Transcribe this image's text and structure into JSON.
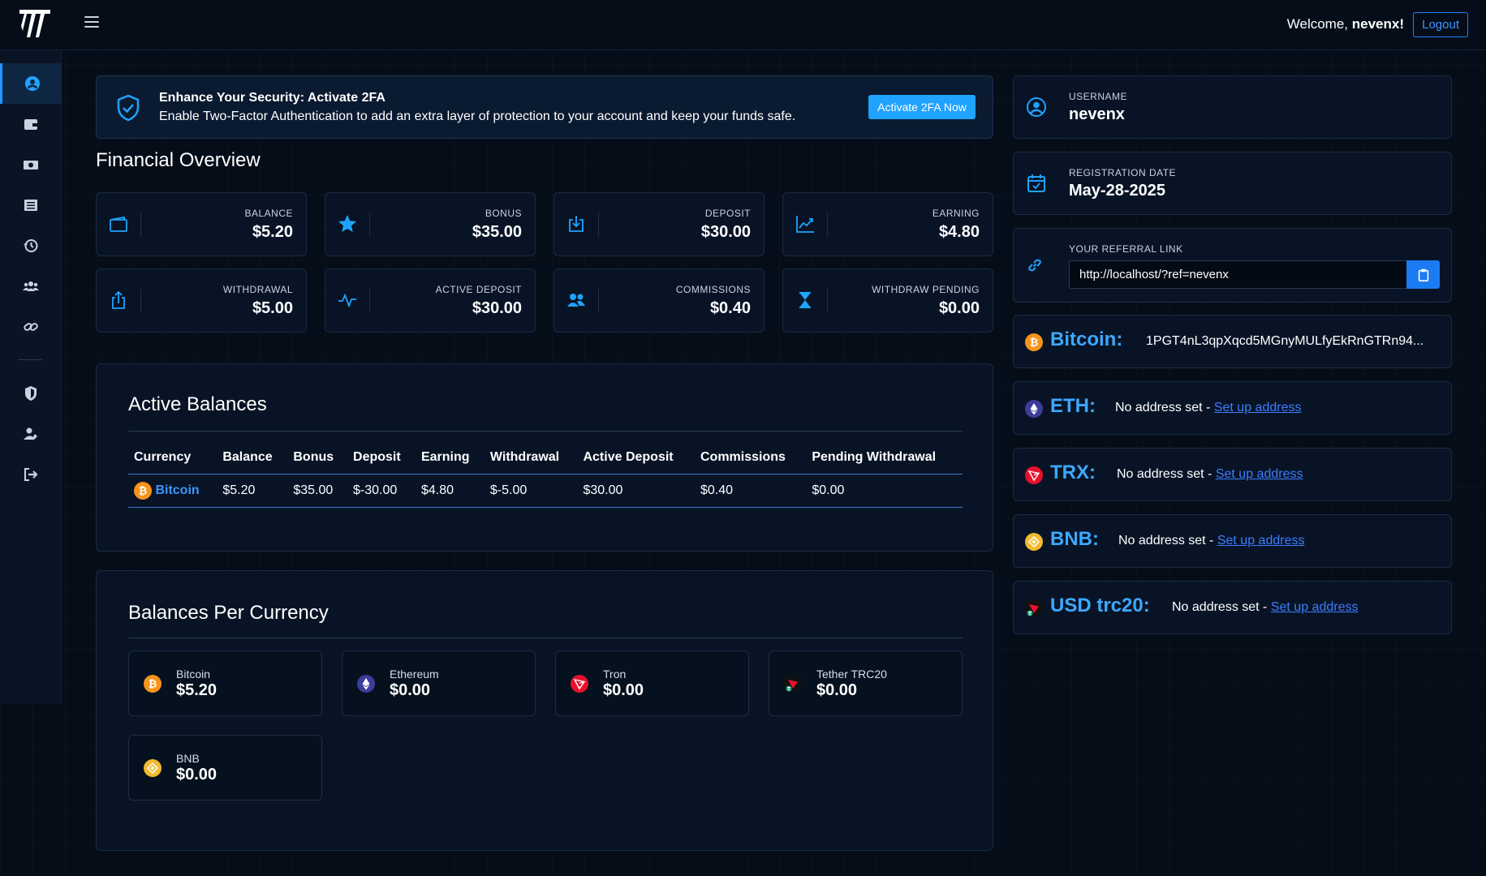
{
  "header": {
    "welcome_prefix": "Welcome,",
    "username": "nevenx!",
    "logout_label": "Logout"
  },
  "sidebar": {
    "items": [
      {
        "icon": "user-circle-icon",
        "active": true
      },
      {
        "icon": "wallet-icon"
      },
      {
        "icon": "money-icon"
      },
      {
        "icon": "list-icon"
      },
      {
        "icon": "history-icon"
      },
      {
        "icon": "users-icon"
      },
      {
        "icon": "link-icon"
      },
      {
        "icon": "shield-icon"
      },
      {
        "icon": "user-edit-icon"
      },
      {
        "icon": "sign-out-icon"
      }
    ]
  },
  "banner": {
    "title": "Enhance Your Security: Activate 2FA",
    "text": "Enable Two-Factor Authentication to add an extra layer of protection to your account and keep your funds safe.",
    "button": "Activate 2FA Now"
  },
  "overview": {
    "title": "Financial Overview",
    "stats": [
      {
        "label": "BALANCE",
        "value": "$5.20",
        "icon": "wallet-icon"
      },
      {
        "label": "BONUS",
        "value": "$35.00",
        "icon": "star-icon"
      },
      {
        "label": "DEPOSIT",
        "value": "$30.00",
        "icon": "download-icon"
      },
      {
        "label": "EARNING",
        "value": "$4.80",
        "icon": "chart-line-icon"
      },
      {
        "label": "WITHDRAWAL",
        "value": "$5.00",
        "icon": "upload-icon"
      },
      {
        "label": "ACTIVE DEPOSIT",
        "value": "$30.00",
        "icon": "pulse-icon"
      },
      {
        "label": "COMMISSIONS",
        "value": "$0.40",
        "icon": "users-icon"
      },
      {
        "label": "WITHDRAW PENDING",
        "value": "$0.00",
        "icon": "hourglass-icon"
      }
    ]
  },
  "active_balances": {
    "title": "Active Balances",
    "headers": [
      "Currency",
      "Balance",
      "Bonus",
      "Deposit",
      "Earning",
      "Withdrawal",
      "Active Deposit",
      "Commissions",
      "Pending Withdrawal"
    ],
    "rows": [
      {
        "currency": "Bitcoin",
        "balance": "$5.20",
        "bonus": "$35.00",
        "deposit": "$-30.00",
        "earning": "$4.80",
        "withdrawal": "$-5.00",
        "active_deposit": "$30.00",
        "commissions": "$0.40",
        "pending": "$0.00"
      }
    ]
  },
  "per_currency": {
    "title": "Balances Per Currency",
    "items": [
      {
        "name": "Bitcoin",
        "value": "$5.20",
        "icon": "bitcoin-icon",
        "color": "#f7931a"
      },
      {
        "name": "Ethereum",
        "value": "$0.00",
        "icon": "ethereum-icon",
        "color": "#3c3c9c"
      },
      {
        "name": "Tron",
        "value": "$0.00",
        "icon": "tron-icon",
        "color": "#e8112d"
      },
      {
        "name": "Tether TRC20",
        "value": "$0.00",
        "icon": "tether-trc20-icon",
        "color": "#111111"
      },
      {
        "name": "BNB",
        "value": "$0.00",
        "icon": "bnb-icon",
        "color": "#f3ba2f"
      }
    ]
  },
  "profile": {
    "username_label": "USERNAME",
    "username": "nevenx",
    "regdate_label": "REGISTRATION DATE",
    "regdate": "May-28-2025",
    "ref_label": "YOUR REFERRAL LINK",
    "ref_link": "http://localhost/?ref=nevenx"
  },
  "wallets": [
    {
      "name": "Bitcoin:",
      "address": "1PGT4nL3qpXqcd5MGnyMULfyEkRnGTRn94...",
      "icon": "bitcoin-icon",
      "color": "#f7931a"
    },
    {
      "name": "ETH:",
      "no_address": "No address set -",
      "setup": "Set up address",
      "icon": "ethereum-icon",
      "color": "#3c3c9c"
    },
    {
      "name": "TRX:",
      "no_address": "No address set -",
      "setup": "Set up address",
      "icon": "tron-icon",
      "color": "#e8112d"
    },
    {
      "name": "BNB:",
      "no_address": "No address set -",
      "setup": "Set up address",
      "icon": "bnb-icon",
      "color": "#f3ba2f"
    },
    {
      "name": "USD trc20:",
      "no_address": "No address set -",
      "setup": "Set up address",
      "icon": "tether-trc20-icon",
      "color": "#111111"
    }
  ]
}
